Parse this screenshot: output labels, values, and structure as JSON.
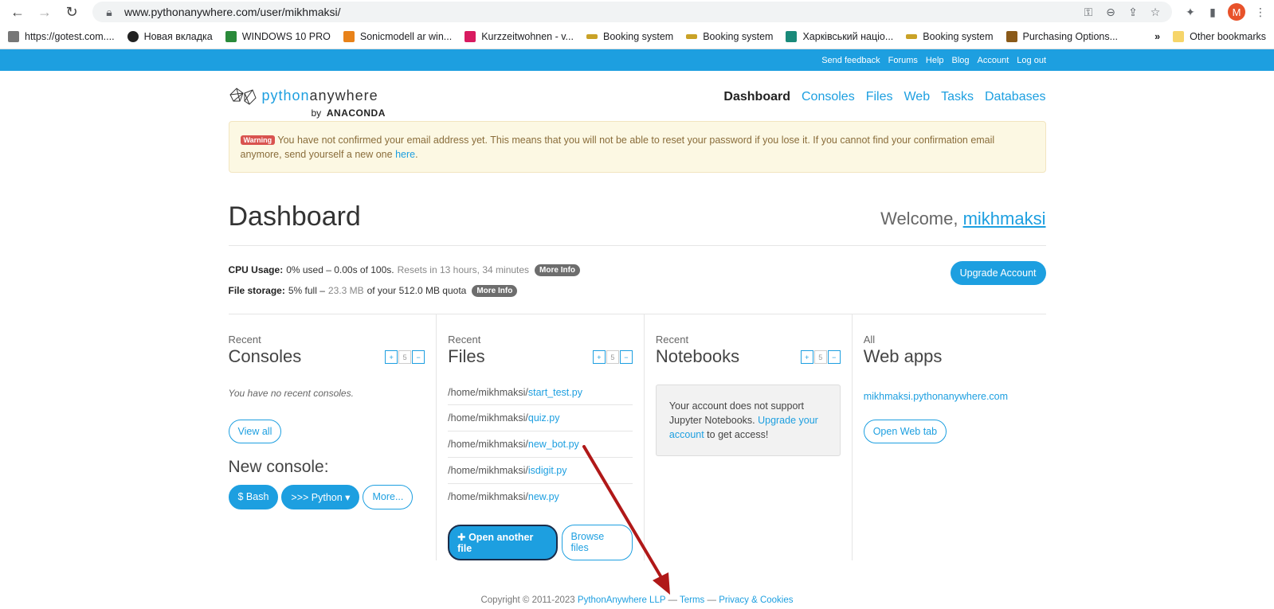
{
  "browser": {
    "url": "www.pythonanywhere.com/user/mikhmaksi/",
    "avatar_letter": "M",
    "bookmarks": [
      {
        "label": "https://gotest.com....",
        "color": "#555"
      },
      {
        "label": "Новая вкладка",
        "color": "#222"
      },
      {
        "label": "WINDOWS 10 PRO",
        "color": "#2a8a3a"
      },
      {
        "label": "Sonicmodell ar win...",
        "color": "#e8821a"
      },
      {
        "label": "Kurzzeitwohnen - v...",
        "color": "#d81b60"
      },
      {
        "label": "Booking system",
        "color": "#c9a227"
      },
      {
        "label": "Booking system",
        "color": "#c9a227"
      },
      {
        "label": "Харківський націо...",
        "color": "#1a8a7a"
      },
      {
        "label": "Booking system",
        "color": "#c9a227"
      },
      {
        "label": "Purchasing Options...",
        "color": "#8a5a1a"
      }
    ],
    "more_bookmarks": "»",
    "other_bookmarks": "Other bookmarks"
  },
  "topbar": {
    "links": [
      "Send feedback",
      "Forums",
      "Help",
      "Blog",
      "Account",
      "Log out"
    ]
  },
  "header": {
    "logo_python": "python",
    "logo_anywhere": "anywhere",
    "logo_by": "by",
    "logo_anaconda": "ANACONDA",
    "nav": [
      "Dashboard",
      "Consoles",
      "Files",
      "Web",
      "Tasks",
      "Databases"
    ]
  },
  "warning": {
    "badge": "Warning",
    "text": " You have not confirmed your email address yet. This means that you will not be able to reset your password if you lose it. If you cannot find your confirmation email anymore, send yourself a new one ",
    "link": "here",
    "end": "."
  },
  "dashboard": {
    "title": "Dashboard",
    "welcome": "Welcome, ",
    "username": "mikhmaksi"
  },
  "usage": {
    "cpu_label": "CPU Usage:",
    "cpu_value": "0% used – 0.00s of 100s.",
    "cpu_reset": "Resets in 13 hours, 34 minutes",
    "storage_label": "File storage:",
    "storage_pct": "5% full –",
    "storage_used": "23.3 MB",
    "storage_quota": "of your 512.0 MB quota",
    "more_info": "More Info",
    "upgrade": "Upgrade Account"
  },
  "consoles": {
    "label": "Recent",
    "title": "Consoles",
    "count": "5",
    "empty": "You have no recent consoles.",
    "view_all": "View all",
    "new_console": "New console:",
    "bash": "$ Bash",
    "python": ">>> Python ▾",
    "more": "More..."
  },
  "files": {
    "label": "Recent",
    "title": "Files",
    "count": "5",
    "items": [
      {
        "dir": "/home/mikhmaksi/",
        "name": "start_test.py"
      },
      {
        "dir": "/home/mikhmaksi/",
        "name": "quiz.py"
      },
      {
        "dir": "/home/mikhmaksi/",
        "name": "new_bot.py"
      },
      {
        "dir": "/home/mikhmaksi/",
        "name": "isdigit.py"
      },
      {
        "dir": "/home/mikhmaksi/",
        "name": "new.py"
      }
    ],
    "open_another": "✚ Open another file",
    "browse": "Browse files"
  },
  "notebooks": {
    "label": "Recent",
    "title": "Notebooks",
    "count": "5",
    "msg_a": "Your account does not support Jupyter Notebooks. ",
    "msg_link": "Upgrade your account",
    "msg_b": " to get access!"
  },
  "webapps": {
    "label": "All",
    "title": "Web apps",
    "link": "mikhmaksi.pythonanywhere.com",
    "open_tab": "Open Web tab"
  },
  "footer": {
    "copyright": "Copyright © 2011-2023 ",
    "company": "PythonAnywhere LLP",
    "sep1": " — ",
    "terms": "Terms",
    "sep2": " — ",
    "privacy": "Privacy & Cookies"
  },
  "colors": {
    "brand": "#1d9fe0",
    "warning_bg": "#fcf8e3",
    "arrow": "#b01818"
  }
}
